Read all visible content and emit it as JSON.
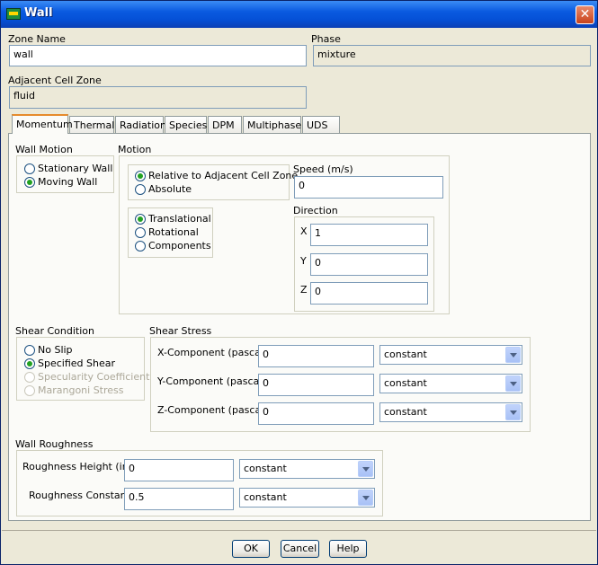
{
  "window": {
    "title": "Wall",
    "close_label": "✕"
  },
  "zone_name": {
    "label": "Zone Name",
    "value": "wall"
  },
  "phase": {
    "label": "Phase",
    "value": "mixture"
  },
  "adjacent_cell_zone": {
    "label": "Adjacent Cell Zone",
    "value": "fluid"
  },
  "tabs": [
    "Momentum",
    "Thermal",
    "Radiation",
    "Species",
    "DPM",
    "Multiphase",
    "UDS"
  ],
  "wall_motion": {
    "label": "Wall Motion",
    "options": [
      "Stationary Wall",
      "Moving Wall"
    ],
    "selected": "Moving Wall"
  },
  "motion": {
    "label": "Motion",
    "reference_options": [
      "Relative to Adjacent Cell Zone",
      "Absolute"
    ],
    "type_options": [
      "Translational",
      "Rotational",
      "Components"
    ],
    "speed_label": "Speed (m/s)",
    "speed_value": "0",
    "direction_label": "Direction",
    "x_label": "X",
    "x_value": "1",
    "y_label": "Y",
    "y_value": "0",
    "z_label": "Z",
    "z_value": "0"
  },
  "shear_condition": {
    "label": "Shear Condition",
    "options": [
      "No Slip",
      "Specified Shear",
      "Specularity Coefficient",
      "Marangoni Stress"
    ]
  },
  "shear_stress": {
    "label": "Shear Stress",
    "x_label": "X-Component (pascal)",
    "x_value": "0",
    "x_method": "constant",
    "y_label": "Y-Component (pascal)",
    "y_value": "0",
    "y_method": "constant",
    "z_label": "Z-Component (pascal)",
    "z_value": "0",
    "z_method": "constant"
  },
  "wall_roughness": {
    "label": "Wall Roughness",
    "height_label": "Roughness Height (in)",
    "height_value": "0",
    "height_method": "constant",
    "constant_label": "Roughness Constant",
    "constant_value": "0.5",
    "constant_method": "constant"
  },
  "buttons": {
    "ok": "OK",
    "cancel": "Cancel",
    "help": "Help"
  },
  "colors": {
    "title_bar": "#0a5ae0",
    "active_tab": "#e68b2c",
    "radio_dot": "#21a121"
  }
}
